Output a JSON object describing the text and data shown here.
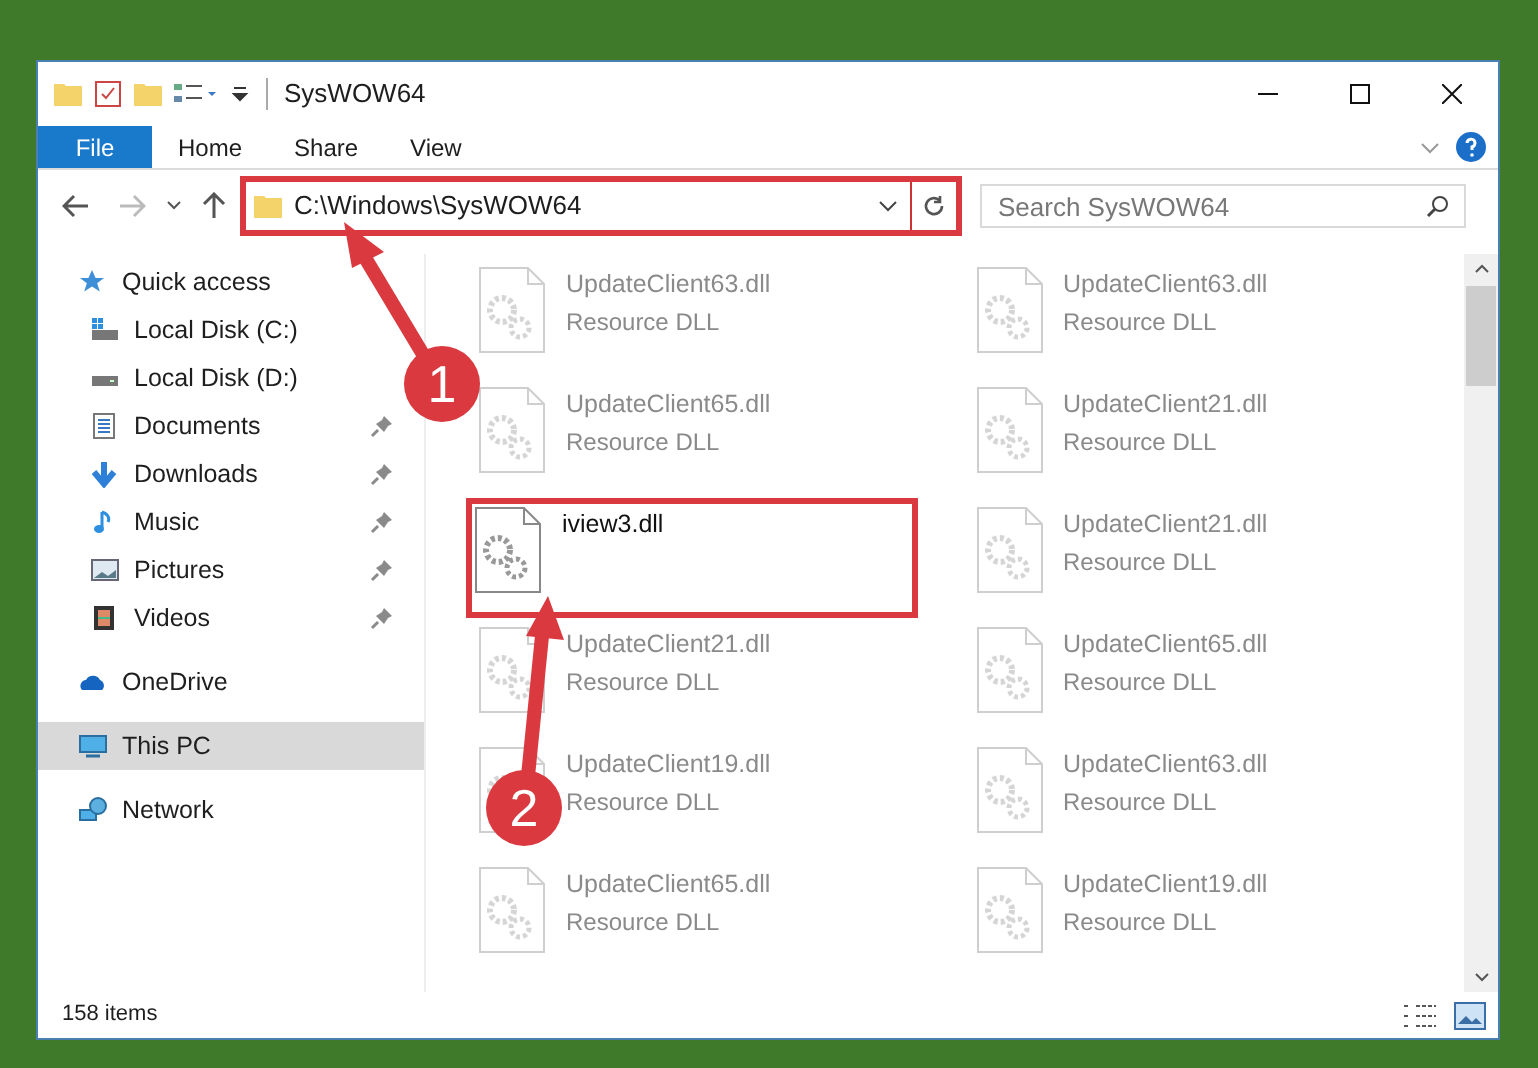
{
  "window": {
    "title": "SysWOW64"
  },
  "ribbon_tabs": [
    {
      "label": "File",
      "kind": "file",
      "selected": false
    },
    {
      "label": "Home",
      "kind": "tab",
      "selected": false
    },
    {
      "label": "Share",
      "kind": "tab",
      "selected": false
    },
    {
      "label": "View",
      "kind": "tab",
      "selected": false
    }
  ],
  "address_bar": {
    "path": "C:\\Windows\\SysWOW64",
    "marked": true
  },
  "search": {
    "placeholder": "Search SysWOW64"
  },
  "sidebar": {
    "items": [
      {
        "label": "Quick access",
        "kind": "star",
        "selected": false,
        "children": [
          {
            "label": "Local Disk (C:)",
            "kind": "drive-system",
            "pinned": false,
            "selected": false
          },
          {
            "label": "Local Disk (D:)",
            "kind": "drive",
            "pinned": false,
            "selected": false
          },
          {
            "label": "Documents",
            "kind": "documents",
            "pinned": true,
            "selected": false
          },
          {
            "label": "Downloads",
            "kind": "downloads",
            "pinned": true,
            "selected": false
          },
          {
            "label": "Music",
            "kind": "music",
            "pinned": true,
            "selected": false
          },
          {
            "label": "Pictures",
            "kind": "pictures",
            "pinned": true,
            "selected": false
          },
          {
            "label": "Videos",
            "kind": "videos",
            "pinned": true,
            "selected": false
          }
        ]
      },
      {
        "label": "OneDrive",
        "kind": "cloud",
        "selected": false
      },
      {
        "label": "This PC",
        "kind": "pc",
        "selected": true
      },
      {
        "label": "Network",
        "kind": "network",
        "selected": false
      }
    ]
  },
  "files": [
    {
      "name": "UpdateClient63.dll",
      "type": "Resource DLL",
      "dimmed": true,
      "marked": false
    },
    {
      "name": "UpdateClient63.dll",
      "type": "Resource DLL",
      "dimmed": true,
      "marked": false
    },
    {
      "name": "UpdateClient65.dll",
      "type": "Resource DLL",
      "dimmed": true,
      "marked": false
    },
    {
      "name": "UpdateClient21.dll",
      "type": "Resource DLL",
      "dimmed": true,
      "marked": false
    },
    {
      "name": "iview3.dll",
      "dimmed": false,
      "marked": true
    },
    {
      "name": "UpdateClient21.dll",
      "type": "Resource DLL",
      "dimmed": true,
      "marked": false
    },
    {
      "name": "UpdateClient21.dll",
      "type": "Resource DLL",
      "dimmed": true,
      "marked": false
    },
    {
      "name": "UpdateClient65.dll",
      "type": "Resource DLL",
      "dimmed": true,
      "marked": false
    },
    {
      "name": "UpdateClient19.dll",
      "type": "Resource DLL",
      "dimmed": true,
      "marked": false
    },
    {
      "name": "UpdateClient63.dll",
      "type": "Resource DLL",
      "dimmed": true,
      "marked": false
    },
    {
      "name": "UpdateClient65.dll",
      "type": "Resource DLL",
      "dimmed": true,
      "marked": false
    },
    {
      "name": "UpdateClient19.dll",
      "type": "Resource DLL",
      "dimmed": true,
      "marked": false
    }
  ],
  "status_bar": {
    "item_count": "158 items"
  },
  "annotations": [
    {
      "number": "1"
    },
    {
      "number": "2"
    }
  ]
}
